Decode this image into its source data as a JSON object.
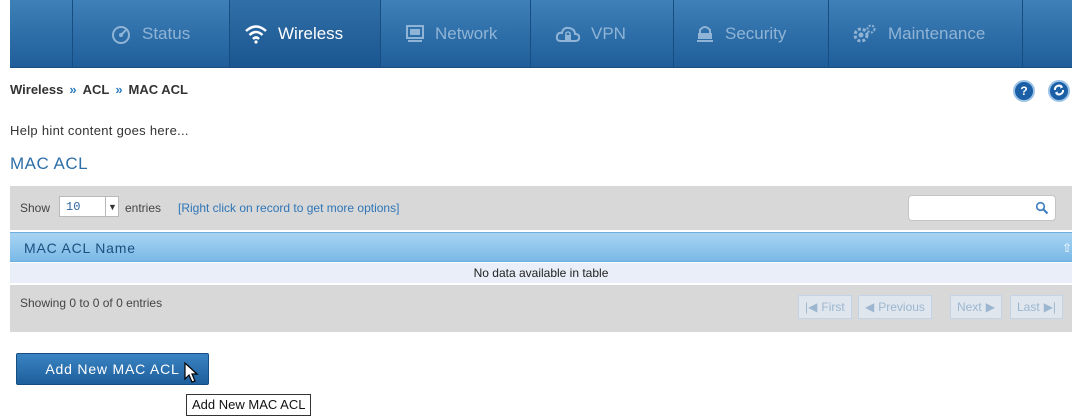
{
  "nav": {
    "items": [
      {
        "label": "Status",
        "icon": "gauge-icon"
      },
      {
        "label": "Wireless",
        "icon": "wifi-icon",
        "active": true
      },
      {
        "label": "Network",
        "icon": "monitor-icon"
      },
      {
        "label": "VPN",
        "icon": "cloud-lock-icon"
      },
      {
        "label": "Security",
        "icon": "lock-icon"
      },
      {
        "label": "Maintenance",
        "icon": "gears-icon"
      }
    ]
  },
  "breadcrumb": {
    "items": [
      "Wireless",
      "ACL",
      "MAC ACL"
    ],
    "separator": "»"
  },
  "header_buttons": {
    "help": "?",
    "refresh_icon": "refresh-icon"
  },
  "hint": "Help hint content goes here...",
  "page_title": "MAC ACL",
  "table": {
    "show_label": "Show",
    "entries_value": "10",
    "entries_label": "entries",
    "options_hint": "[Right click on record to get more options]",
    "search_placeholder": "",
    "column_header": "MAC ACL Name",
    "empty_text": "No data available in table",
    "info_text": "Showing 0 to 0 of 0 entries",
    "pagination": {
      "first": "First",
      "previous": "Previous",
      "next": "Next",
      "last": "Last"
    }
  },
  "add_button": {
    "label": "Add New MAC ACL",
    "tooltip": "Add New MAC ACL"
  },
  "colors": {
    "nav_bg": "#2a6aa6",
    "accent": "#2f76b8",
    "header_blue": "#8cc6ec",
    "button": "#2a6fae"
  }
}
